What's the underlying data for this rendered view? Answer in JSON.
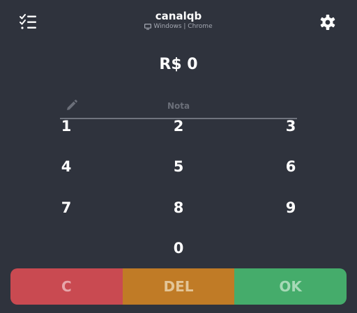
{
  "header": {
    "title": "canalqb",
    "platform": "Windows | Chrome",
    "left_icon": "checklist-icon",
    "right_icon": "gear-icon"
  },
  "amount": "R$ 0",
  "note": {
    "placeholder": "Nota",
    "value": "",
    "icon": "pencil-icon"
  },
  "keypad": {
    "k1": "1",
    "k2": "2",
    "k3": "3",
    "k4": "4",
    "k5": "5",
    "k6": "6",
    "k7": "7",
    "k8": "8",
    "k9": "9",
    "k0": "0"
  },
  "actions": {
    "clear_label": "C",
    "delete_label": "DEL",
    "ok_label": "OK"
  },
  "colors": {
    "background": "#2f333d",
    "clear": "#c94a51",
    "delete": "#c07b26",
    "ok": "#45ac6b"
  }
}
